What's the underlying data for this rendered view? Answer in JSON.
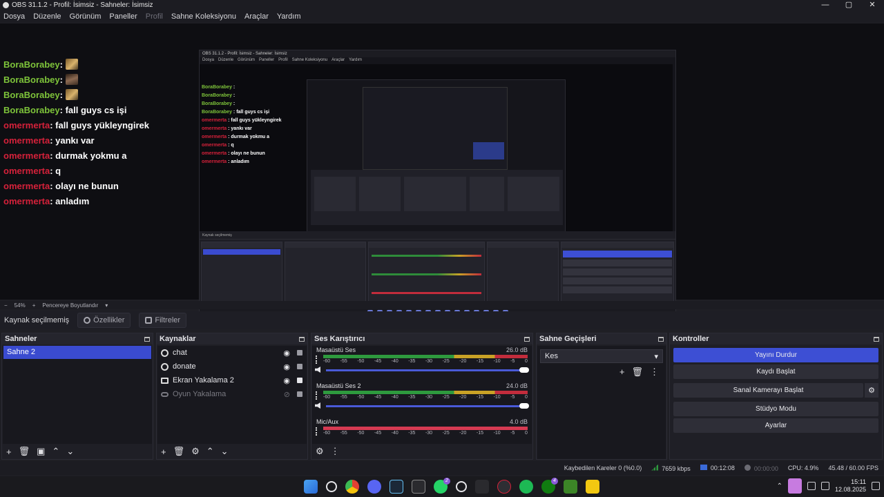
{
  "window": {
    "title": "OBS 31.1.2 - Profil: İsimsiz - Sahneler: İsimsiz",
    "controls": [
      "—",
      "▢",
      "✕"
    ]
  },
  "menu": [
    "Dosya",
    "Düzenle",
    "Görünüm",
    "Paneller",
    "Profil",
    "Sahne Koleksiyonu",
    "Araçlar",
    "Yardım"
  ],
  "chat": [
    {
      "user": "BoraBorabey",
      "msg": " : ",
      "color": "green",
      "emote": "gold"
    },
    {
      "user": "BoraBorabey",
      "msg": " : ",
      "color": "green",
      "emote": "face"
    },
    {
      "user": "BoraBorabey",
      "msg": " : ",
      "color": "green",
      "emote": "gold"
    },
    {
      "user": "BoraBorabey",
      "msg": " : fall guys cs işi",
      "color": "green"
    },
    {
      "user": "omermerta",
      "msg": " : fall guys yükleyngirek",
      "color": "red"
    },
    {
      "user": "omermerta",
      "msg": " : yankı var",
      "color": "red"
    },
    {
      "user": "omermerta",
      "msg": " : durmak yokmu a",
      "color": "red"
    },
    {
      "user": "omermerta",
      "msg": " : q",
      "color": "red"
    },
    {
      "user": "omermerta",
      "msg": " : olayı ne bunun",
      "color": "red"
    },
    {
      "user": "omermerta",
      "msg": " : anladım",
      "color": "red"
    }
  ],
  "nested": {
    "title": "OBS 31.1.2 - Profil: İsimsiz - Sahneler: İsimsiz",
    "menu": [
      "Dosya",
      "Düzenle",
      "Görünüm",
      "Paneller",
      "Profil",
      "Sahne Koleksiyonu",
      "Araçlar",
      "Yardım"
    ]
  },
  "zoom": {
    "value": "54%",
    "label": "Pencereye Boyutlandır"
  },
  "sourcebar": {
    "status": "Kaynak seçilmemiş",
    "properties": "Özellikler",
    "filters": "Filtreler"
  },
  "scenes": {
    "title": "Sahneler",
    "items": [
      "Sahne 2"
    ]
  },
  "sources": {
    "title": "Kaynaklar",
    "items": [
      {
        "name": "chat",
        "icon": "globe-icon",
        "disabled": false
      },
      {
        "name": "donate",
        "icon": "globe-icon",
        "disabled": false
      },
      {
        "name": "Ekran Yakalama 2",
        "icon": "monitor-icon",
        "disabled": false
      },
      {
        "name": "Oyun Yakalama",
        "icon": "gamepad-icon",
        "disabled": true
      }
    ]
  },
  "mixer": {
    "title": "Ses Karıştırıcı",
    "ticks": [
      "-60",
      "-55",
      "-50",
      "-45",
      "-40",
      "-35",
      "-30",
      "-25",
      "-20",
      "-15",
      "-10",
      "-5",
      "0"
    ],
    "channels": [
      {
        "name": "Masaüstü Ses",
        "db": "26.0 dB"
      },
      {
        "name": "Masaüstü Ses 2",
        "db": "24.0 dB"
      },
      {
        "name": "Mic/Aux",
        "db": "4.0 dB"
      }
    ]
  },
  "transitions": {
    "title": "Sahne Geçişleri",
    "selected": "Kes"
  },
  "controls": {
    "title": "Kontroller",
    "stop_stream": "Yayını Durdur",
    "start_record": "Kaydı Başlat",
    "virtual_cam": "Sanal Kamerayı Başlat",
    "studio_mode": "Stüdyo Modu",
    "settings": "Ayarlar"
  },
  "status": {
    "dropped": "Kaybedilen Kareler 0 (%0.0)",
    "bitrate": "7659 kbps",
    "stream_time": "00:12:08",
    "rec_time": "00:00:00",
    "cpu": "CPU: 4.9%",
    "fps": "45.48 / 60.00 FPS"
  },
  "taskbar": {
    "time": "15:11",
    "date": "12.08.2025",
    "badge_whatsapp": "2",
    "badge_xbox": "4"
  }
}
